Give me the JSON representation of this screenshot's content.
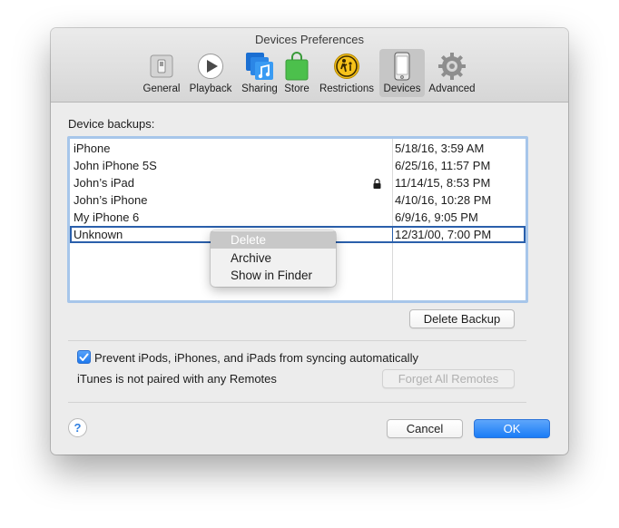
{
  "window": {
    "title": "Devices Preferences"
  },
  "toolbar": {
    "items": [
      {
        "label": "General",
        "icon": "general-switch-icon"
      },
      {
        "label": "Playback",
        "icon": "play-icon"
      },
      {
        "label": "Sharing",
        "icon": "sharing-music-icon"
      },
      {
        "label": "Store",
        "icon": "store-bag-icon"
      },
      {
        "label": "Restrictions",
        "icon": "restrictions-icon"
      },
      {
        "label": "Devices",
        "icon": "iphone-icon",
        "selected": true
      },
      {
        "label": "Advanced",
        "icon": "gear-icon"
      }
    ]
  },
  "backups": {
    "label": "Device backups:",
    "rows": [
      {
        "name": "iPhone",
        "date": "5/18/16, 3:59 AM",
        "locked": false
      },
      {
        "name": "John iPhone 5S",
        "date": "6/25/16, 11:57 PM",
        "locked": false
      },
      {
        "name": "John’s iPad",
        "date": "11/14/15, 8:53 PM",
        "locked": true
      },
      {
        "name": "John’s iPhone",
        "date": "4/10/16, 10:28 PM",
        "locked": false
      },
      {
        "name": "My iPhone 6",
        "date": "6/9/16, 9:05 PM",
        "locked": false
      },
      {
        "name": "Unknown",
        "date": "12/31/00, 7:00 PM",
        "locked": false,
        "focused": true
      }
    ],
    "delete_button": "Delete Backup"
  },
  "context_menu": {
    "items": [
      {
        "label": "Delete",
        "disabled": true
      },
      {
        "label": "Archive",
        "disabled": false
      },
      {
        "label": "Show in Finder",
        "disabled": false
      }
    ]
  },
  "sync": {
    "checkbox_label": "Prevent iPods, iPhones, and iPads from syncing automatically",
    "checked": true,
    "remotes_text": "iTunes is not paired with any Remotes",
    "forget_button": "Forget All Remotes"
  },
  "footer": {
    "help": "?",
    "cancel": "Cancel",
    "ok": "OK"
  },
  "colors": {
    "accent": "#1a7cf6",
    "selection_border": "#2a5fab",
    "table_focus_ring": "#a7c6ea"
  }
}
